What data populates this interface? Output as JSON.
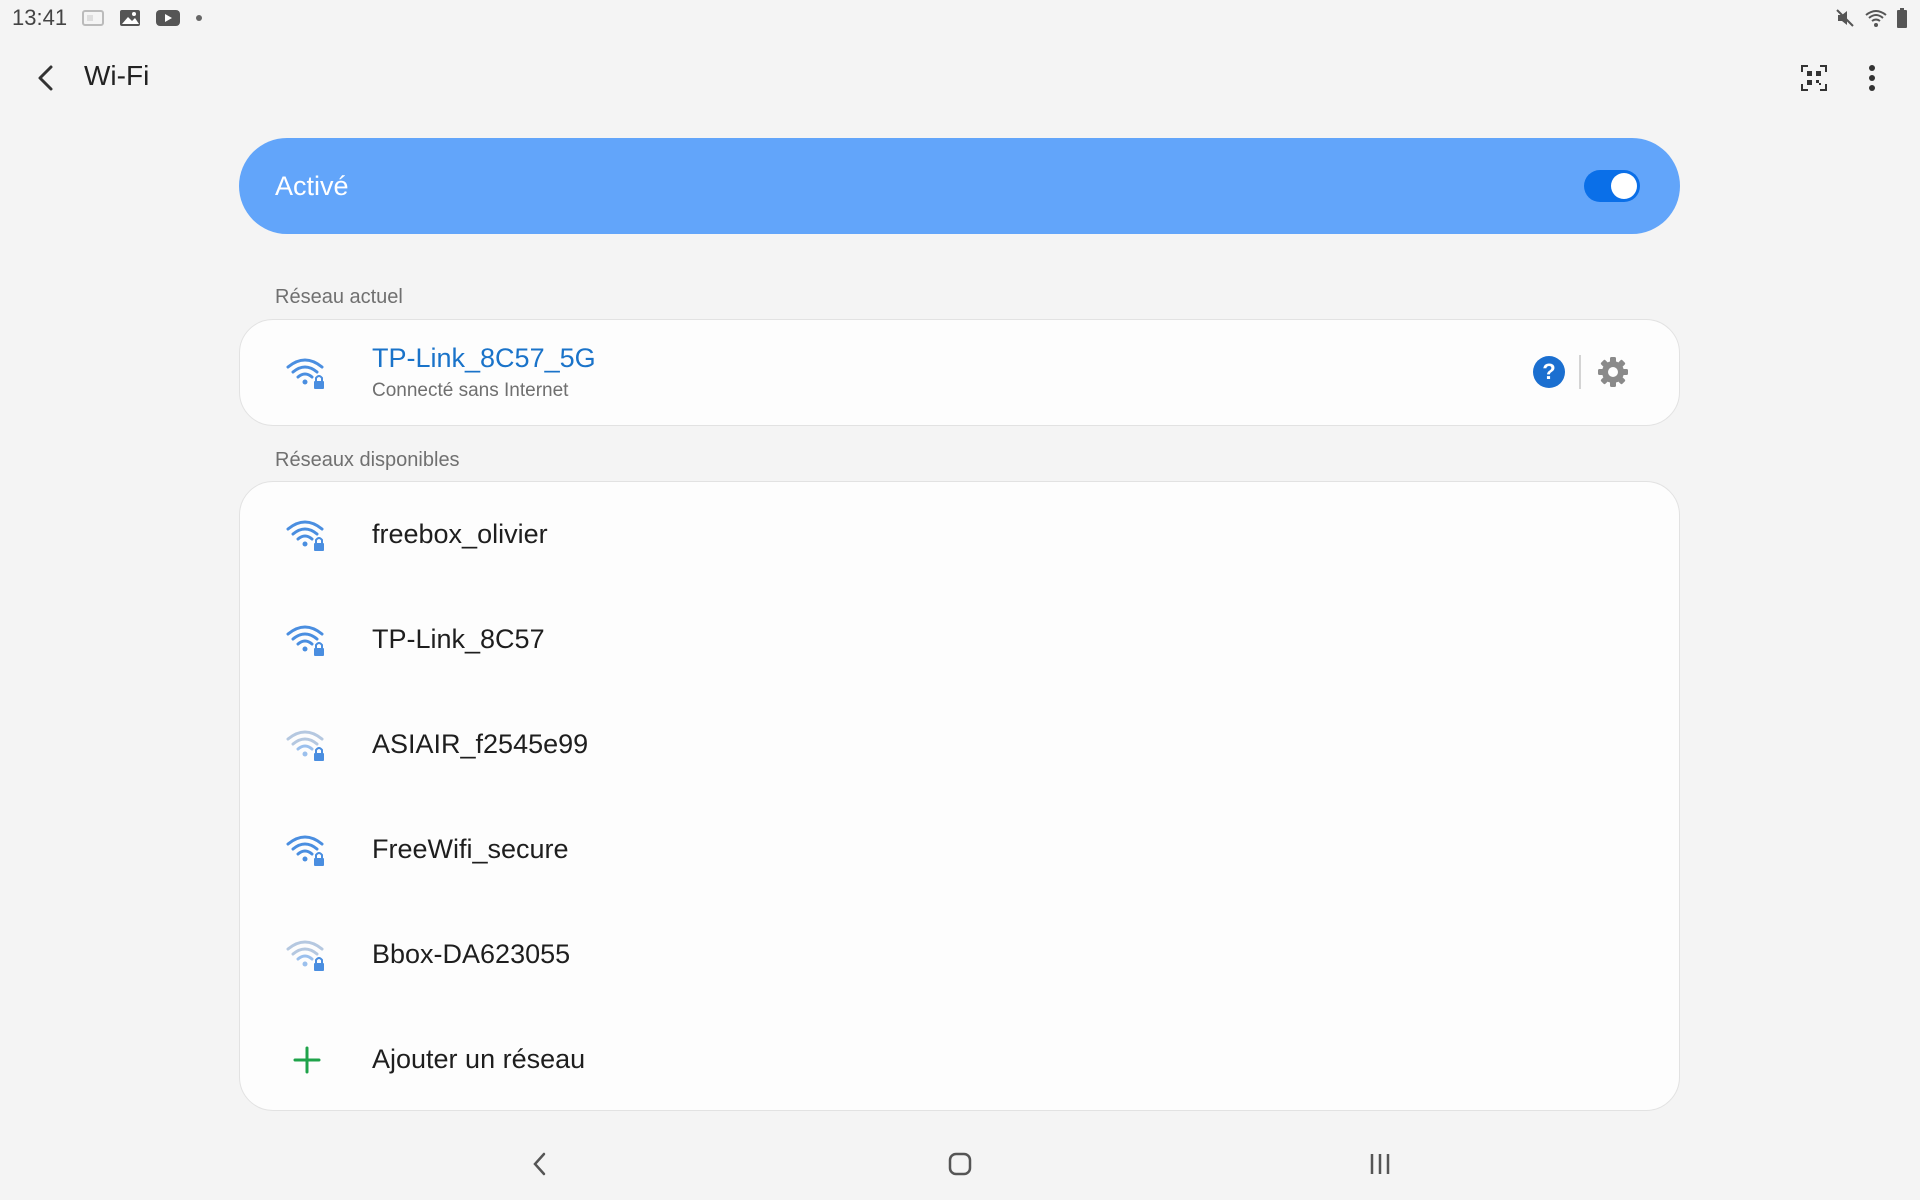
{
  "status_bar": {
    "time": "13:41",
    "left_icons": [
      "gallery-icon",
      "image-icon",
      "youtube-icon",
      "dot-icon"
    ],
    "right_icons": [
      "mute-icon",
      "wifi-icon",
      "battery-icon"
    ]
  },
  "header": {
    "title": "Wi-Fi",
    "back_icon": "back-arrow-icon",
    "actions": [
      "qr-scan-icon",
      "more-options-icon"
    ]
  },
  "master_switch": {
    "label": "Activé",
    "enabled": true
  },
  "current_network": {
    "section_label": "Réseau actuel",
    "name": "TP-Link_8C57_5G",
    "status": "Connecté sans Internet",
    "signal_icon": "wifi-lock-icon",
    "actions": [
      "help-icon",
      "settings-gear-icon"
    ]
  },
  "available_networks": {
    "section_label": "Réseaux disponibles",
    "items": [
      {
        "name": "freebox_olivier",
        "signal": "strong"
      },
      {
        "name": "TP-Link_8C57",
        "signal": "strong"
      },
      {
        "name": "ASIAIR_f2545e99",
        "signal": "weak"
      },
      {
        "name": "FreeWifi_secure",
        "signal": "strong"
      },
      {
        "name": "Bbox-DA623055",
        "signal": "weak"
      }
    ],
    "add_label": "Ajouter un réseau"
  },
  "nav_bar": {
    "buttons": [
      "nav-back-icon",
      "nav-home-icon",
      "nav-recents-icon"
    ]
  },
  "colors": {
    "master_card": "#62a5fa",
    "switch_on": "#0a6fe8",
    "connected_text": "#1a73c9",
    "wifi_strong": "#4a8ee0",
    "wifi_weak": "#b5c8e0",
    "add_plus": "#1fa34a"
  }
}
